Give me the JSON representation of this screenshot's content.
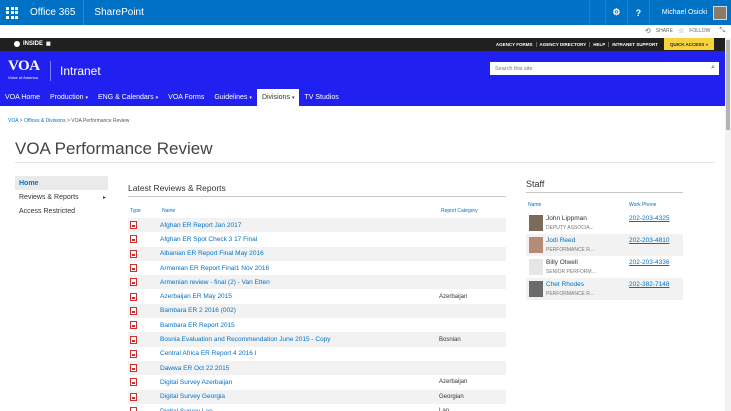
{
  "suite": {
    "app_launcher": "app-launcher-icon",
    "brand": "Office 365",
    "app": "SharePoint",
    "settings_icon": "⚙",
    "help_icon": "?",
    "user_name": "Michael Osicki"
  },
  "actions": {
    "share_label": "SHARE",
    "follow_label": "FOLLOW"
  },
  "topbar": {
    "inside_label": "INSIDE",
    "links": [
      "AGENCY FORMS",
      "AGENCY DIRECTORY",
      "HELP",
      "INTRANET SUPPORT"
    ],
    "quick_access": "QUICK ACCESS »"
  },
  "header": {
    "logo_text": "VOA",
    "logo_sub": "Voice of America",
    "site_title": "Intranet",
    "search_placeholder": "Search this site"
  },
  "nav": {
    "items": [
      {
        "label": "VOA Home",
        "dropdown": false
      },
      {
        "label": "Production",
        "dropdown": true
      },
      {
        "label": "ENG & Calendars",
        "dropdown": true
      },
      {
        "label": "VOA Forms",
        "dropdown": false
      },
      {
        "label": "Guidelines",
        "dropdown": true
      },
      {
        "label": "Divisions",
        "dropdown": true,
        "active": true
      },
      {
        "label": "TV Studios",
        "dropdown": false
      }
    ]
  },
  "breadcrumb": {
    "items": [
      "VOA",
      "Offices & Divisions",
      "VOA Performance Review"
    ],
    "separator": ">"
  },
  "page": {
    "title": "VOA Performance Review"
  },
  "quicklaunch": {
    "items": [
      {
        "label": "Home",
        "selected": true,
        "arrow": false
      },
      {
        "label": "Reviews & Reports",
        "selected": false,
        "arrow": true
      },
      {
        "label": "Access Restricted",
        "selected": false,
        "arrow": false
      }
    ]
  },
  "reviews": {
    "title": "Latest Reviews & Reports",
    "columns": {
      "type": "Type",
      "name": "Name",
      "category": "Report Category"
    },
    "rows": [
      {
        "name": "Afghan ER Report Jan 2017",
        "category": ""
      },
      {
        "name": "Afghan ER Spot Check 3 17 Final",
        "category": ""
      },
      {
        "name": "Albanian ER Report Final May 2016",
        "category": ""
      },
      {
        "name": "Armenian ER Report Final1 Nov 2016",
        "category": ""
      },
      {
        "name": "Armenian review - final (2) - Van Etten",
        "category": ""
      },
      {
        "name": "Azerbaijan ER May 2015",
        "category": "Azerbaijan"
      },
      {
        "name": "Bambara ER 2 2016 (002)",
        "category": ""
      },
      {
        "name": "Bambara ER Report 2015",
        "category": ""
      },
      {
        "name": "Bosnia Evaluation and Recommendation June 2015 - Copy",
        "category": "Bosnian"
      },
      {
        "name": "Central Africa ER Report 4 2016 I",
        "category": ""
      },
      {
        "name": "Dawwa ER Oct 22 2015",
        "category": ""
      },
      {
        "name": "Digital Survey Azerbaijan",
        "category": "Azerbaijan"
      },
      {
        "name": "Digital Survey Georgia",
        "category": "Georgian"
      },
      {
        "name": "Digital Survey Lao",
        "category": "Lao"
      }
    ]
  },
  "staff": {
    "title": "Staff",
    "columns": {
      "name": "Name",
      "phone": "Work Phone"
    },
    "rows": [
      {
        "name": "John Lippman",
        "title": "DEPUTY ASSOCIA...",
        "phone": "202-203-4325",
        "link": false,
        "photo_color": "#7c6a5a"
      },
      {
        "name": "Jodi Reed",
        "title": "PERFORMANCE R...",
        "phone": "202-203-4810",
        "link": true,
        "photo_color": "#b58b76"
      },
      {
        "name": "Billy Otwell",
        "title": "SENIOR PERFORM...",
        "phone": "202-203-4336",
        "link": false,
        "photo_color": "#e6e6e6"
      },
      {
        "name": "Chet Rhodes",
        "title": "PERFORMANCE R...",
        "phone": "202-382-7148",
        "link": true,
        "photo_color": "#6a6a6a"
      }
    ]
  },
  "colors": {
    "suite_blue": "#0072c6",
    "header_blue": "#2020f0",
    "link_blue": "#0072c6",
    "quick_access_yellow": "#f6d33d"
  }
}
